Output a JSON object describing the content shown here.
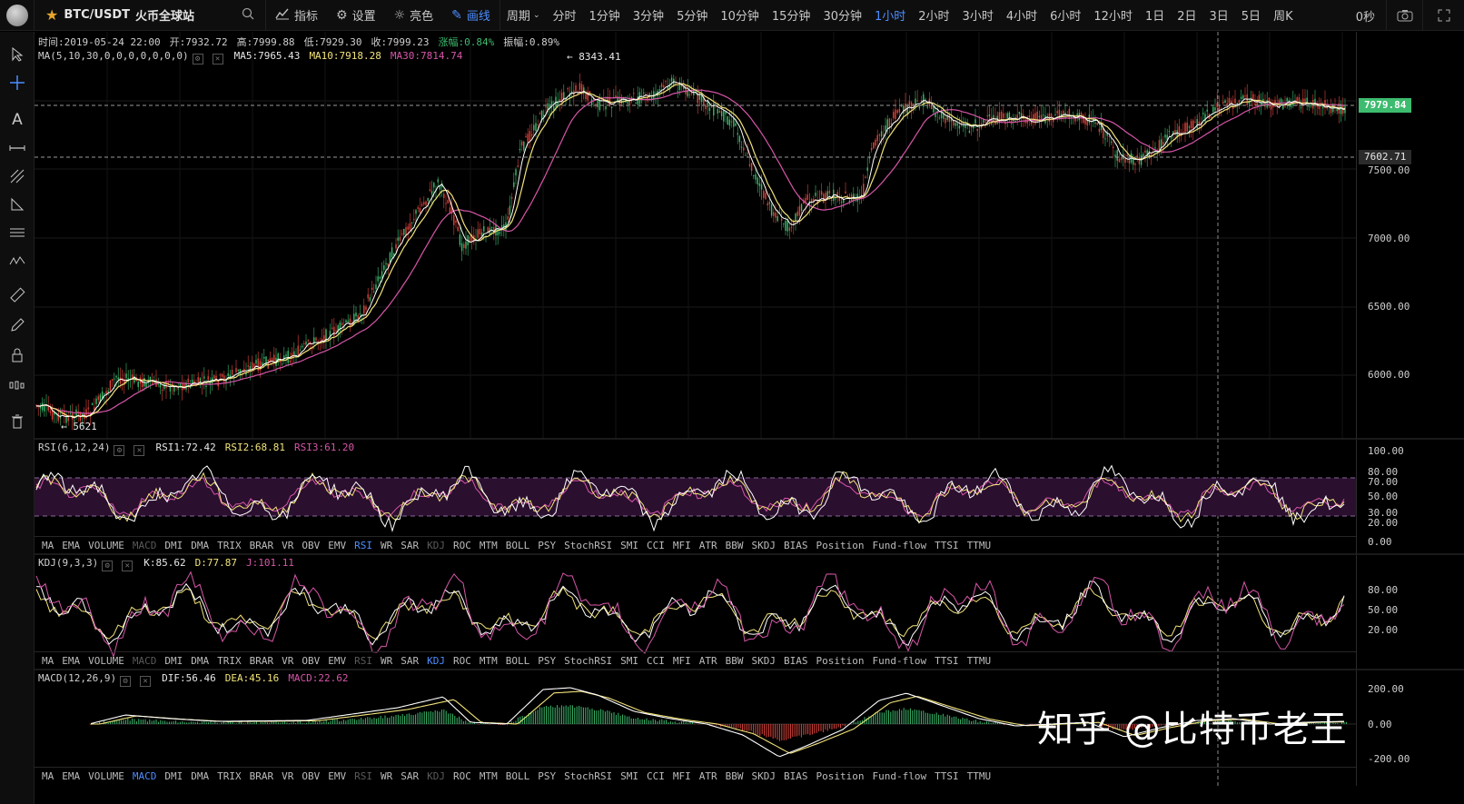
{
  "header": {
    "pair": "BTC/USDT",
    "market": "火币全球站",
    "tools": [
      {
        "icon": "indicator-icon",
        "label": "指标"
      },
      {
        "icon": "settings-icon",
        "label": "设置"
      },
      {
        "icon": "brightness-icon",
        "label": "亮色"
      },
      {
        "icon": "draw-line-icon",
        "label": "画线"
      }
    ],
    "period_label": "周期",
    "periods": [
      "分时",
      "1分钟",
      "3分钟",
      "5分钟",
      "10分钟",
      "15分钟",
      "30分钟",
      "1小时",
      "2小时",
      "3小时",
      "4小时",
      "6小时",
      "12小时",
      "1日",
      "2日",
      "3日",
      "5日",
      "周K"
    ],
    "active_period": "1小时",
    "countdown": "0秒"
  },
  "ohlc": {
    "time": "时间:2019-05-24 22:00",
    "open": "开:7932.72",
    "high": "高:7999.88",
    "low": "低:7929.30",
    "close": "收:7999.23",
    "change": "涨幅:0.84%",
    "amplitude": "振幅:0.89%"
  },
  "ma_legend": {
    "name": "MA(5,10,30,0,0,0,0,0,0,0)",
    "ma5": "MA5:7965.43",
    "ma10": "MA10:7918.28",
    "ma30": "MA30:7814.74"
  },
  "annotations": {
    "high": "← 8343.41",
    "low": "← 5621"
  },
  "price_axis": {
    "ticks": [
      "7500.00",
      "7000.00",
      "6500.00",
      "6000.00"
    ],
    "current": "7979.84",
    "crosshair": "7602.71"
  },
  "rsi": {
    "name": "RSI(6,12,24)",
    "rsi1": "RSI1:72.42",
    "rsi2": "RSI2:68.81",
    "rsi3": "RSI3:61.20",
    "ticks": [
      "100.00",
      "80.00",
      "70.00",
      "50.00",
      "30.00",
      "20.00",
      "0.00"
    ]
  },
  "kdj": {
    "name": "KDJ(9,3,3)",
    "k": "K:85.62",
    "d": "D:77.87",
    "j": "J:101.11",
    "ticks": [
      "80.00",
      "50.00",
      "20.00"
    ]
  },
  "macd": {
    "name": "MACD(12,26,9)",
    "dif": "DIF:56.46",
    "dea": "DEA:45.16",
    "macd": "MACD:22.62",
    "ticks": [
      "200.00",
      "0.00",
      "-200.00"
    ]
  },
  "indicator_tabs": [
    "MA",
    "EMA",
    "VOLUME",
    "MACD",
    "DMI",
    "DMA",
    "TRIX",
    "BRAR",
    "VR",
    "OBV",
    "EMV",
    "RSI",
    "WR",
    "SAR",
    "KDJ",
    "ROC",
    "MTM",
    "BOLL",
    "PSY",
    "StochRSI",
    "SMI",
    "CCI",
    "MFI",
    "ATR",
    "BBW",
    "SKDJ",
    "BIAS",
    "Position",
    "Fund-flow",
    "TTSI",
    "TTMU"
  ],
  "watermark": "知乎 @比特币老王",
  "colors": {
    "up": "#3dbb6e",
    "down": "#e0453c",
    "ma5": "#ffffff",
    "ma10": "#f2e37a",
    "ma30": "#d656a8",
    "accent": "#4d8dff"
  }
}
